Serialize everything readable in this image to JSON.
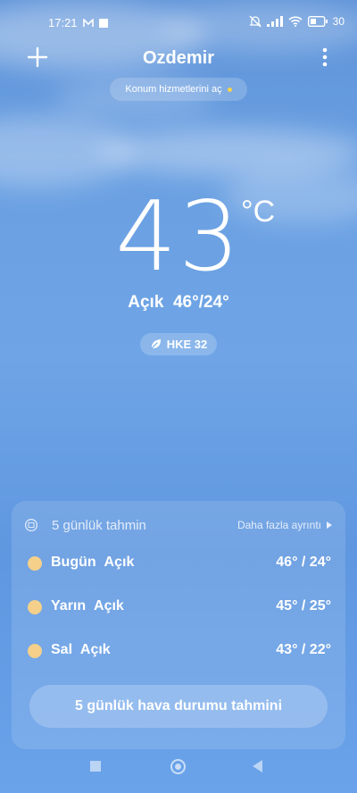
{
  "status": {
    "time": "17:21",
    "battery": "30"
  },
  "header": {
    "city": "Ozdemir"
  },
  "location_prompt": "Konum hizmetlerini aç",
  "current": {
    "temperature": "43",
    "unit": "°C",
    "condition": "Açık",
    "high_low": "46°/24°",
    "aqi_label": "HKE 32"
  },
  "forecast": {
    "title": "5 günlük tahmin",
    "more_label": "Daha fazla ayrıntı",
    "days": [
      {
        "day": "Bugün",
        "condition": "Açık",
        "temps": "46° / 24°"
      },
      {
        "day": "Yarın",
        "condition": "Açık",
        "temps": "45° / 25°"
      },
      {
        "day": "Sal",
        "condition": "Açık",
        "temps": "43° / 22°"
      }
    ],
    "button_label": "5 günlük hava durumu tahmini"
  },
  "colors": {
    "sun": "#f4d08a",
    "dot": "#f7d24a",
    "sky": "#6fa5e6"
  },
  "icons": [
    "mail-icon",
    "stop-icon",
    "bell-muted-icon",
    "signal-icon",
    "wifi-icon",
    "battery-icon",
    "plus-icon",
    "more-vert-icon",
    "leaf-icon",
    "calendar-icon",
    "chevron-right-icon",
    "sun-icon"
  ]
}
